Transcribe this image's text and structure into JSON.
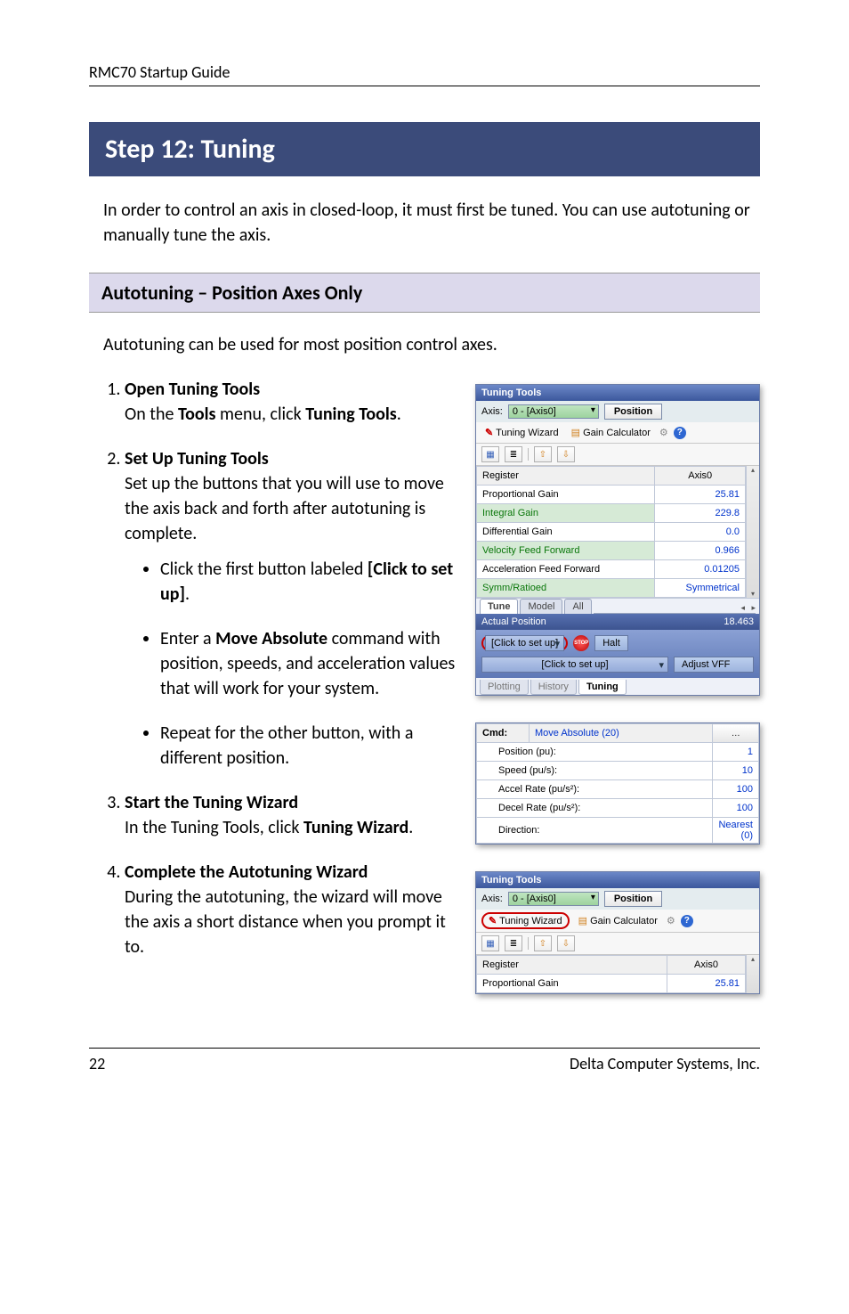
{
  "header": {
    "title": "RMC70 Startup Guide"
  },
  "step_banner": "Step 12: Tuning",
  "intro": "In order to control an axis in closed-loop, it must first be tuned. You can use autotuning or manually tune the axis.",
  "section_banner": "Autotuning – Position Axes Only",
  "section_text": "Autotuning can be used for most position control axes.",
  "steps": [
    {
      "title": "Open Tuning Tools",
      "body_before": "On the ",
      "body_bold": "Tools",
      "body_mid": " menu, click ",
      "body_bold2": "Tuning Tools",
      "body_after": "."
    },
    {
      "title": "Set Up Tuning Tools",
      "body": "Set up the buttons that you will use to move the axis back and forth after autotuning is complete."
    },
    {
      "title": "Start the Tuning Wizard",
      "body_before": "In the Tuning Tools, click ",
      "body_bold": "Tuning Wizard",
      "body_after": "."
    },
    {
      "title": "Complete the Autotuning Wizard",
      "body": "During the autotuning, the wizard will move the axis a short distance when you prompt it to."
    }
  ],
  "bullets": [
    {
      "pre": "Click the first button labeled ",
      "bold": "[Click to set up]",
      "post": "."
    },
    {
      "pre": "Enter a ",
      "bold": "Move Absolute",
      "post": " command with position, speeds, and acceleration values that will work for your system."
    },
    {
      "pre": "Repeat for the other button, with a different position.",
      "bold": "",
      "post": ""
    }
  ],
  "panel1": {
    "title": "Tuning Tools",
    "axis_label": "Axis:",
    "axis_value": "0 - [Axis0]",
    "position_btn": "Position",
    "tuning_wizard": "Tuning Wizard",
    "gain_calc": "Gain Calculator",
    "reg_header": "Register",
    "axis_header": "Axis0",
    "rows": [
      {
        "name": "Proportional Gain",
        "val": "25.81"
      },
      {
        "name": "Integral Gain",
        "val": "229.8"
      },
      {
        "name": "Differential Gain",
        "val": "0.0"
      },
      {
        "name": "Velocity Feed Forward",
        "val": "0.966"
      },
      {
        "name": "Acceleration Feed Forward",
        "val": "0.01205"
      },
      {
        "name": "Symm/Ratioed",
        "val": "Symmetrical"
      }
    ],
    "tabs_mid": {
      "tune": "Tune",
      "model": "Model",
      "all": "All"
    },
    "actual_pos_label": "Actual Position",
    "actual_pos_val": "18.463",
    "click_setup": "[Click to set up]",
    "halt": "Halt",
    "adjust": "Adjust VFF",
    "bottom_tabs": {
      "plotting": "Plotting",
      "history": "History",
      "tuning": "Tuning"
    }
  },
  "panel2": {
    "cmd_label": "Cmd:",
    "cmd_value": "Move Absolute (20)",
    "rows": [
      {
        "name": "Position (pu):",
        "val": "1"
      },
      {
        "name": "Speed (pu/s):",
        "val": "10"
      },
      {
        "name": "Accel Rate (pu/s²):",
        "val": "100"
      },
      {
        "name": "Decel Rate (pu/s²):",
        "val": "100"
      },
      {
        "name": "Direction:",
        "val": "Nearest (0)"
      }
    ]
  },
  "panel3": {
    "title": "Tuning Tools",
    "axis_label": "Axis:",
    "axis_value": "0 - [Axis0]",
    "position_btn": "Position",
    "tuning_wizard": "Tuning Wizard",
    "gain_calc": "Gain Calculator",
    "reg_header": "Register",
    "axis_header": "Axis0",
    "row_name": "Proportional Gain",
    "row_val": "25.81"
  },
  "footer": {
    "page": "22",
    "company": "Delta Computer Systems, Inc."
  }
}
